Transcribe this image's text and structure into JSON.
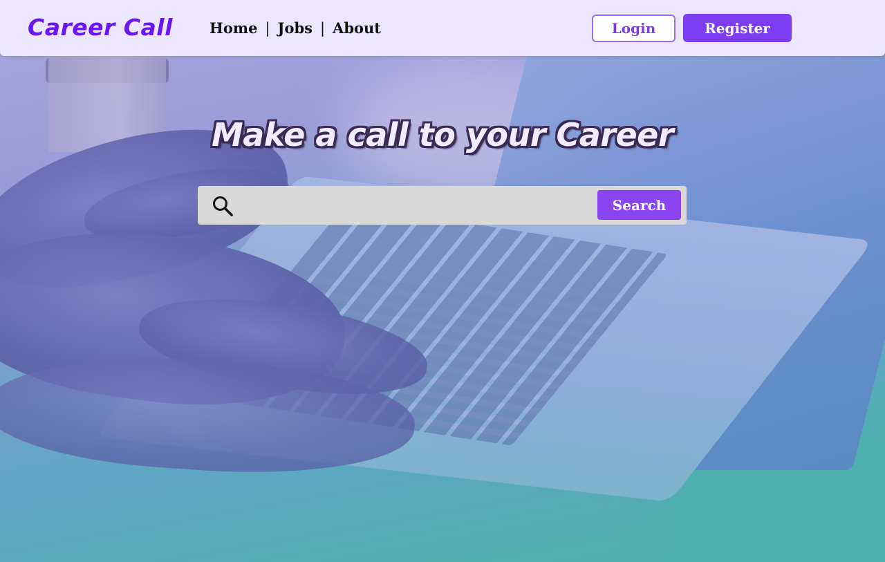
{
  "brand": {
    "name": "Career Call",
    "color": "#6a16f0"
  },
  "nav": {
    "links": [
      "Home",
      "Jobs",
      "About"
    ],
    "separator": "|"
  },
  "auth": {
    "login_label": "Login",
    "register_label": "Register",
    "accent": "#7d3df2"
  },
  "hero": {
    "headline": "Make a call to your Career",
    "background_image": "hands-typing-on-laptop"
  },
  "search": {
    "icon": "search-icon",
    "value": "",
    "placeholder": "",
    "button_label": "Search",
    "button_color": "#8b44f2"
  }
}
